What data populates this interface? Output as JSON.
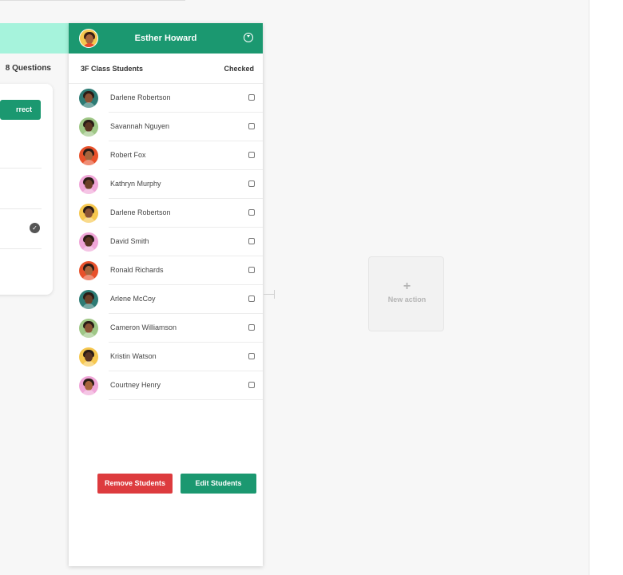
{
  "left_panel": {
    "questions_count": "8 Questions",
    "correct_button_label": "rrect"
  },
  "panel": {
    "user_name": "Esther Howard",
    "class_name": "3F Class Students",
    "checked_label": "Checked",
    "students": [
      {
        "name": "Darlene Robertson",
        "avatar_bg": "#2d7b74",
        "checked": false
      },
      {
        "name": "Savannah Nguyen",
        "avatar_bg": "#9fc786",
        "checked": false
      },
      {
        "name": "Robert Fox",
        "avatar_bg": "#e8512b",
        "checked": false
      },
      {
        "name": "Kathryn Murphy",
        "avatar_bg": "#f0a6d8",
        "checked": false
      },
      {
        "name": "Darlene Robertson",
        "avatar_bg": "#f6c74f",
        "checked": false
      },
      {
        "name": "David Smith",
        "avatar_bg": "#f0a6d8",
        "checked": false
      },
      {
        "name": "Ronald Richards",
        "avatar_bg": "#e8512b",
        "checked": false
      },
      {
        "name": "Arlene McCoy",
        "avatar_bg": "#2d7b74",
        "checked": false
      },
      {
        "name": "Cameron Williamson",
        "avatar_bg": "#9fc786",
        "checked": false
      },
      {
        "name": "Kristin Watson",
        "avatar_bg": "#f6c74f",
        "checked": false
      },
      {
        "name": "Courtney Henry",
        "avatar_bg": "#f0a6d8",
        "checked": false
      }
    ],
    "remove_button_label": "Remove Students",
    "edit_button_label": "Edit Students"
  },
  "new_action": {
    "icon": "plus-icon",
    "label": "New action"
  },
  "colors": {
    "primary": "#1b9870",
    "danger": "#dd3b3e",
    "accent_light": "#a6f3dc"
  }
}
